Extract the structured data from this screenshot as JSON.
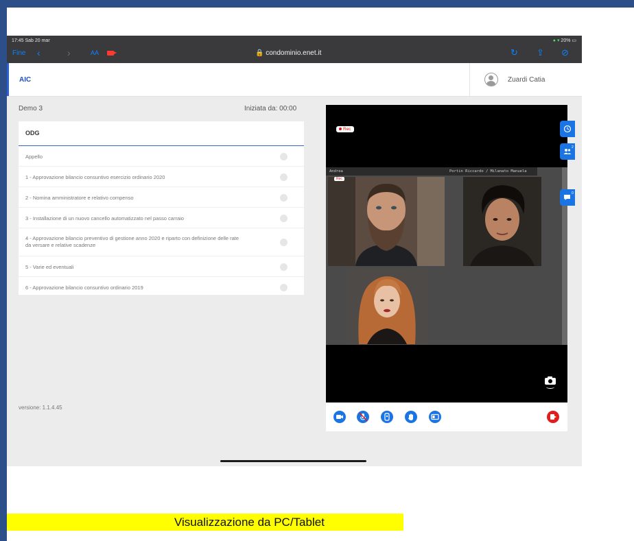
{
  "status_bar": {
    "time": "17:45  Sab 20 mar",
    "battery": "20%"
  },
  "browser": {
    "done_label": "Fine",
    "text_size_label": "AA",
    "url": "condominio.enet.it"
  },
  "app": {
    "brand": "AIC",
    "user_name": "Zuardi Catia"
  },
  "meeting": {
    "title": "Demo 3",
    "started": "Iniziata da: 00:00",
    "odg_title": "ODG",
    "items": [
      "Appello",
      "1 - Approvazione bilancio consuntivo esercizio ordinario 2020",
      "2 - Nomina amministratore e relativo compenso",
      "3 - Installazione di un nuovo cancello automatizzato nel passo carraio",
      "4 - Approvazione bilancio preventivo di gestione anno 2020 e riparto con definizione delle rate da versare e relative scadenze",
      "5 - Varie ed eventuali",
      "6 - Approvazione bilancio consuntivo ordinario 2019"
    ],
    "version": "versione: 1.1.4.45"
  },
  "video": {
    "rec_label": "Rec",
    "tile1_name": "Andrea",
    "tile2_name": "Portin Riccardo / Milanato Manuela",
    "tile_rec_label": "Rec"
  },
  "sidebar": {
    "participants_count": "2",
    "chat_count": "0"
  },
  "caption": "Visualizzazione da PC/Tablet",
  "colors": {
    "accent": "#1b74e4",
    "exit": "#e11d1d",
    "frame": "#2c4f8a",
    "highlight": "#ffff00"
  }
}
